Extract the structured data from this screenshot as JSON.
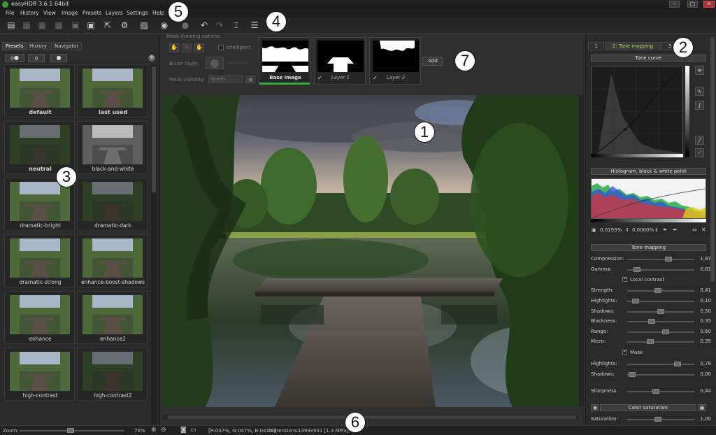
{
  "window": {
    "title": "easyHDR 3.6.1  64bit",
    "controls": {
      "minimize": "–",
      "maximize": "□",
      "close": "✕"
    }
  },
  "menu": [
    "File",
    "History",
    "View",
    "Image",
    "Presets",
    "Layers",
    "Settings",
    "Help"
  ],
  "toolbar_icons": [
    "new-file-icon",
    "open-icon",
    "open-multi-icon",
    "batch-icon",
    "save-disabled-icon",
    "save-icon",
    "export-icon",
    "settings-gear-icon",
    "image-icon",
    "navigate-icon",
    "undo-icon",
    "redo-icon",
    "crop-icon",
    "layers-icon"
  ],
  "callouts": [
    "1",
    "2",
    "3",
    "4",
    "5",
    "6",
    "7"
  ],
  "left_panel": {
    "tabs": [
      "Presets",
      "History",
      "Navigator"
    ],
    "active_tab": "Presets",
    "preset_buttons": [
      "⌂●",
      "⌂",
      "●"
    ],
    "presets": [
      {
        "name": "default",
        "bold": true,
        "tone": "normal"
      },
      {
        "name": "last used",
        "bold": true,
        "tone": "normal"
      },
      {
        "name": "neutral",
        "bold": true,
        "tone": "dark"
      },
      {
        "name": "black-and-white",
        "bold": false,
        "tone": "bw"
      },
      {
        "name": "dramatic-bright",
        "bold": false,
        "tone": "normal"
      },
      {
        "name": "dramatic-dark",
        "bold": false,
        "tone": "dark"
      },
      {
        "name": "dramatic-strong",
        "bold": false,
        "tone": "normal"
      },
      {
        "name": "enhance-boost-shadows",
        "bold": false,
        "tone": "normal"
      },
      {
        "name": "enhance",
        "bold": false,
        "tone": "normal"
      },
      {
        "name": "enhance2",
        "bold": false,
        "tone": "normal"
      },
      {
        "name": "high-contrast",
        "bold": false,
        "tone": "normal"
      },
      {
        "name": "high-contrast2",
        "bold": false,
        "tone": "dark"
      }
    ]
  },
  "mask_options": {
    "title": "Mask drawing options",
    "intelligent_label": "Intelligent",
    "brush_style_label": "Brush style:",
    "mask_visibility_label": "Mask visibility:",
    "mask_visibility_value": "Green"
  },
  "layers": [
    {
      "label": "Base image",
      "active": true
    },
    {
      "label": "Layer 1",
      "active": false
    },
    {
      "label": "Layer 2",
      "active": false
    }
  ],
  "add_button": "Add",
  "right_panel": {
    "tabs": [
      "1",
      "2: Tone mapping",
      "3"
    ],
    "active_tab": "2: Tone mapping",
    "tone_curve_header": "Tone curve",
    "histogram_header": "Histogram, black & white point",
    "black_point": "0,0193%",
    "white_point": "0,0000%",
    "tone_mapping_header": "Tone mapping",
    "local_contrast_label": "Local contrast",
    "mask_label": "Mask",
    "color_saturation_header": "Color saturation",
    "sliders": [
      {
        "label": "Compression:",
        "value": "1,87",
        "pos": 0.63
      },
      {
        "label": "Gamma:",
        "value": "0,81",
        "pos": 0.1
      },
      {
        "label": "Strength:",
        "value": "0,41",
        "pos": 0.45
      },
      {
        "label": "Highlights:",
        "value": "0,10",
        "pos": 0.08
      },
      {
        "label": "Shadows:",
        "value": "0,50",
        "pos": 0.5
      },
      {
        "label": "Blackness:",
        "value": "0,35",
        "pos": 0.35
      },
      {
        "label": "Range:",
        "value": "0,60",
        "pos": 0.58
      },
      {
        "label": "Micro:",
        "value": "0,35",
        "pos": 0.32
      },
      {
        "label": "Highlights:",
        "value": "0,78",
        "pos": 0.78
      },
      {
        "label": "Shadows:",
        "value": "0,00",
        "pos": 0.02
      },
      {
        "label": "Sharpness:",
        "value": "0,44",
        "pos": 0.42
      },
      {
        "label": "Saturation:",
        "value": "1,00",
        "pos": 0.45
      }
    ]
  },
  "status": {
    "zoom_label": "Zoom:",
    "zoom_value": "76%",
    "rgb": "[R:047%, G:047%, B:041%]",
    "dimensions_label": "Dimensions:",
    "dimensions_value": "1399x931 [1.3 MPix]"
  },
  "colors": {
    "accent": "#aee05a",
    "active_layer": "#2fae3a",
    "background": "#2e2e2e"
  }
}
